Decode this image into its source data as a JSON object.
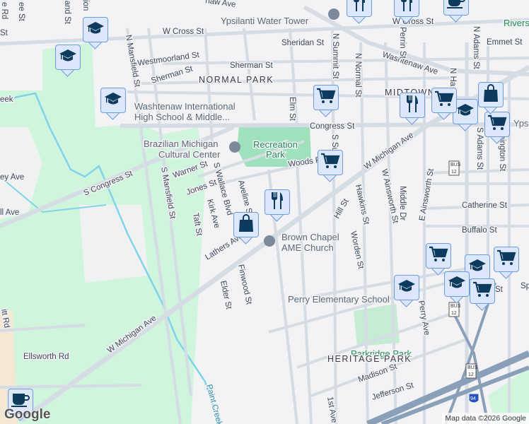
{
  "map": {
    "colors": {
      "background": "#f3f2f4",
      "park": "#cff5dd",
      "road": "#d5dce4",
      "highway": "#8aa0b8",
      "marker_fill": "#dde7fb",
      "marker_border": "#6e9be0",
      "icon": "#0d3b5e",
      "water": "#7fd3ea"
    },
    "streets": {
      "w_cross": "W Cross St",
      "washtenaw": "Washtenaw Ave",
      "washtenaw_top": "naw Ave",
      "sheridan": "Sheridan St",
      "westmoorland": "Westmoorland St",
      "sherman": "Sherman St",
      "sherman2": "Sherman St",
      "n_mansfield": "N Mansfield St",
      "n_summit": "N Summit St",
      "n_normal": "N Normal St",
      "perrin": "Perrin St",
      "n_adams": "N Adams St",
      "emmet": "Emmet St",
      "n_ha": "N Ha",
      "elm": "Elm St",
      "congress": "Congress St",
      "s_congress": "S Congress St",
      "warner": "Warner St",
      "jones": "Jones St",
      "s_mansfield": "S Mansfield St",
      "s_wallace": "S Wallace Blvd",
      "aveline": "Aveline S",
      "kirk": "Kirk Ave",
      "taft": "Taft St",
      "lathers": "Lathers Ave",
      "woods": "Woods R",
      "s_su": "S Su",
      "w_michigan": "W Michigan Ave",
      "w_michigan2": "W Michigan Ave",
      "hill": "Hill St",
      "hawkins": "Hawkins St",
      "w_ainsworth": "W Ainsworth St",
      "middle": "Middle Dr",
      "e_ainsworth": "E Ainsworth St",
      "s_adams": "S Adams St",
      "washington": "Washington St",
      "catherine": "Catherine St",
      "buffalo": "Buffalo St",
      "worden": "Worden St",
      "finwood": "Finwood St",
      "elder": "Elder St",
      "perry": "Perry Ave",
      "ellsworth": "Ellsworth Rd",
      "madison": "Madison St",
      "jefferson": "Jefferson St",
      "first": "1st Ave",
      "paint_creek": "Paint Creek",
      "ee": "ee St",
      "tland": "tland St",
      "ion": "ion",
      "e_rd": "e Rd",
      "st_left": "St",
      "ey_ave": "ey Ave",
      "ll_ave": "ll Ave",
      "itt_rd": "itt Rd",
      "sp": "Sp",
      "st_right": "St"
    },
    "pois": {
      "water_tower": "Ypsilanti Water Tower",
      "washtenaw_intl": "Washtenaw International",
      "washtenaw_intl2": "High School & Middle...",
      "brazilian1": "Brazilian Michigan",
      "brazilian2": "Cultural Center",
      "rec_park1": "Recreation",
      "rec_park2": "Park",
      "brown1": "Brown Chapel",
      "brown2": "AME Church",
      "perry_school": "Perry Elementary School",
      "parkridge": "Parkridge Park",
      "rivers": "Rivers",
      "ypsi": "Ypsi",
      "creek": "eek"
    },
    "neighborhoods": {
      "normal_park": "NORMAL PARK",
      "midtown": "MIDTOWN",
      "heritage_park": "HERITAGE PARK"
    },
    "shields": {
      "bus": "BUS",
      "route12": "12",
      "i94": "94"
    },
    "attribution": "Map data ©2026 Google",
    "logo": "Google"
  }
}
